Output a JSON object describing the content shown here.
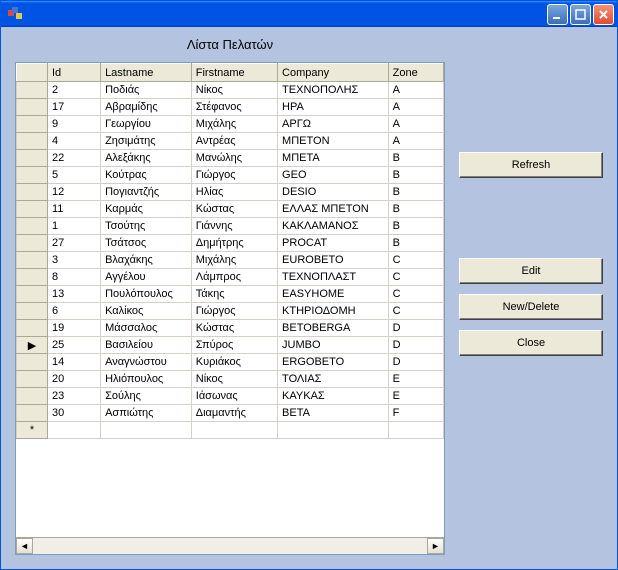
{
  "window": {
    "title": ""
  },
  "page": {
    "title": "Λίστα Πελατών"
  },
  "columns": {
    "id": "Id",
    "lastname": "Lastname",
    "firstname": "Firstname",
    "company": "Company",
    "zone": "Zone"
  },
  "rows": [
    {
      "id": "2",
      "lastname": "Ποδιάς",
      "firstname": "Νίκος",
      "company": "ΤΕΧΝΟΠΟΛΗΣ",
      "zone": "A",
      "current": false
    },
    {
      "id": "17",
      "lastname": "Αβραμίδης",
      "firstname": "Στέφανος",
      "company": "ΗΡΑ",
      "zone": "A",
      "current": false
    },
    {
      "id": "9",
      "lastname": "Γεωργίου",
      "firstname": "Μιχάλης",
      "company": "ΑΡΓΩ",
      "zone": "A",
      "current": false
    },
    {
      "id": "4",
      "lastname": "Ζησιμάτης",
      "firstname": "Αντρέας",
      "company": "ΜΠΕΤΟΝ",
      "zone": "A",
      "current": false
    },
    {
      "id": "22",
      "lastname": "Αλεξάκης",
      "firstname": "Μανώλης",
      "company": "ΜΠΕΤΑ",
      "zone": "B",
      "current": false
    },
    {
      "id": "5",
      "lastname": "Κούτρας",
      "firstname": "Γιώργος",
      "company": "GEO",
      "zone": "B",
      "current": false
    },
    {
      "id": "12",
      "lastname": "Πογιαντζής",
      "firstname": "Ηλίας",
      "company": "DESIO",
      "zone": "B",
      "current": false
    },
    {
      "id": "11",
      "lastname": "Καρμάς",
      "firstname": "Κώστας",
      "company": "ΕΛΛΑΣ ΜΠΕΤΟΝ",
      "zone": "B",
      "current": false
    },
    {
      "id": "1",
      "lastname": "Τσούτης",
      "firstname": "Γιάννης",
      "company": "ΚΑΚΛΑΜΑΝΟΣ",
      "zone": "B",
      "current": false
    },
    {
      "id": "27",
      "lastname": "Τσάτσος",
      "firstname": "Δημήτρης",
      "company": "PROCAT",
      "zone": "B",
      "current": false
    },
    {
      "id": "3",
      "lastname": "Βλαχάκης",
      "firstname": "Μιχάλης",
      "company": "EUROBETO",
      "zone": "C",
      "current": false
    },
    {
      "id": "8",
      "lastname": "Αγγέλου",
      "firstname": "Λάμπρος",
      "company": "ΤΕΧΝΟΠΛΑΣΤ",
      "zone": "C",
      "current": false
    },
    {
      "id": "13",
      "lastname": "Πουλόπουλος",
      "firstname": "Τάκης",
      "company": "EASYHOME",
      "zone": "C",
      "current": false
    },
    {
      "id": "6",
      "lastname": "Καλίκος",
      "firstname": "Γιώργος",
      "company": "ΚΤΗΡΙΟΔΟΜΗ",
      "zone": "C",
      "current": false
    },
    {
      "id": "19",
      "lastname": "Μάσσαλος",
      "firstname": "Κώστας",
      "company": "BETOBERGA",
      "zone": "D",
      "current": false
    },
    {
      "id": "25",
      "lastname": "Βασιλείου",
      "firstname": "Σπύρος",
      "company": "JUMBO",
      "zone": "D",
      "current": true
    },
    {
      "id": "14",
      "lastname": "Αναγνώστου",
      "firstname": "Κυριάκος",
      "company": "ERGOBETO",
      "zone": "D",
      "current": false
    },
    {
      "id": "20",
      "lastname": "Ηλιόπουλος",
      "firstname": "Νίκος",
      "company": "ΤΟΛΙΑΣ",
      "zone": "E",
      "current": false
    },
    {
      "id": "23",
      "lastname": "Σούλης",
      "firstname": "Ιάσωνας",
      "company": "ΚΑΥΚΑΣ",
      "zone": "E",
      "current": false
    },
    {
      "id": "30",
      "lastname": "Ασπιώτης",
      "firstname": "Διαμαντής",
      "company": "BETA",
      "zone": "F",
      "current": false
    }
  ],
  "buttons": {
    "refresh": "Refresh",
    "edit": "Edit",
    "newdelete": "New/Delete",
    "close": "Close"
  },
  "new_row_indicator": "*"
}
